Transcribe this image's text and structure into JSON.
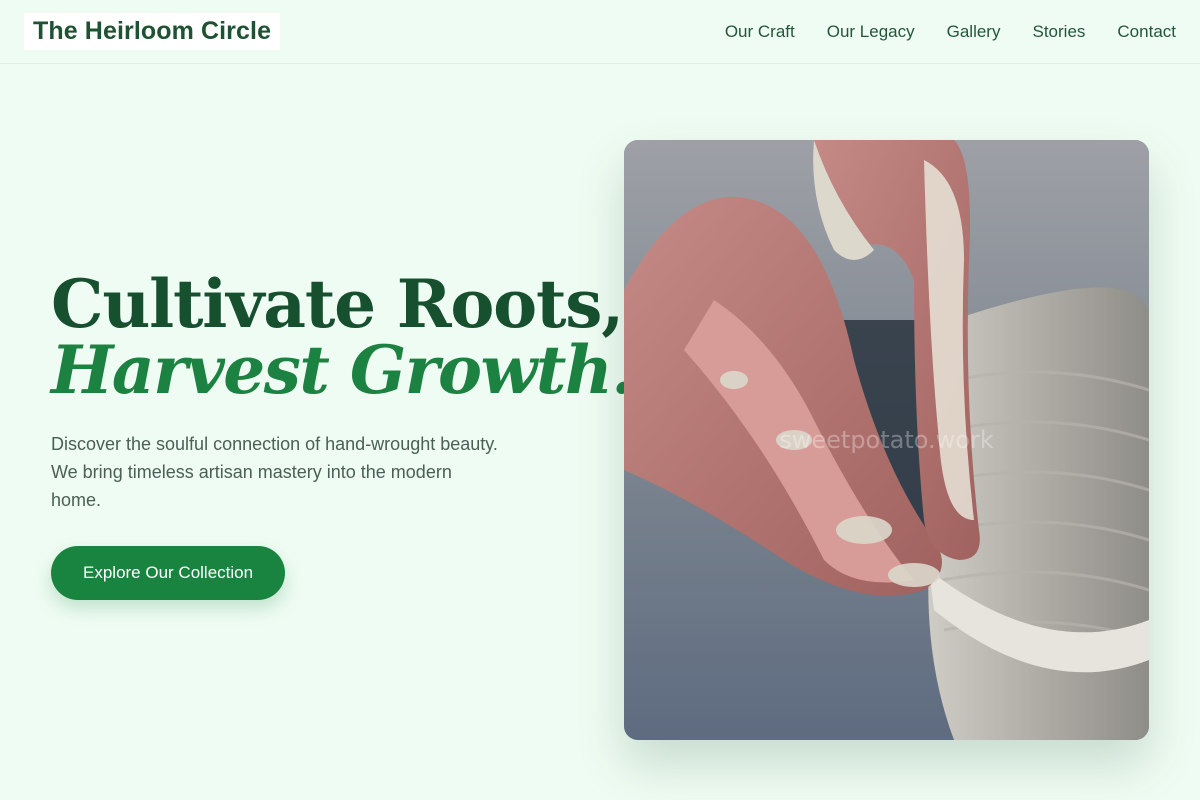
{
  "header": {
    "brand": "The Heirloom Circle",
    "nav": [
      "Our Craft",
      "Our Legacy",
      "Gallery",
      "Stories",
      "Contact"
    ]
  },
  "hero": {
    "title_line1": "Cultivate Roots,",
    "title_line2": "Harvest Growth.",
    "subtitle": "Discover the soulful connection of hand-wrought beauty. We bring timeless artisan mastery into the modern home.",
    "cta_label": "Explore Our Collection"
  },
  "image": {
    "watermark": "sweetpotato.work",
    "subject": "hands-shaping-clay-pot-icon"
  },
  "colors": {
    "background": "#effcf3",
    "brand_dark": "#17502f",
    "accent": "#1c8241",
    "button": "#18843f"
  }
}
